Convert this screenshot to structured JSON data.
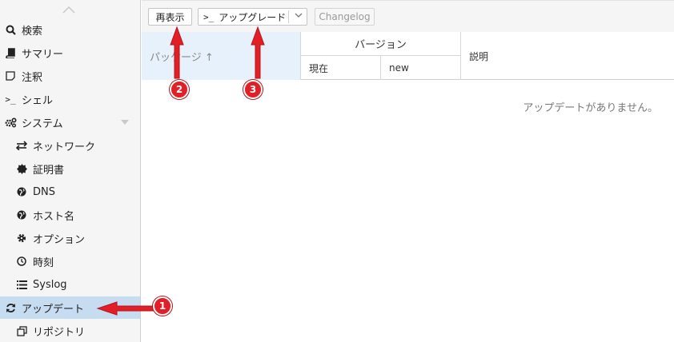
{
  "sidebar": {
    "items": [
      {
        "label": "検索",
        "icon": "search-icon"
      },
      {
        "label": "サマリー",
        "icon": "book-icon"
      },
      {
        "label": "注釈",
        "icon": "note-icon"
      },
      {
        "label": "シェル",
        "icon": "terminal-icon"
      },
      {
        "label": "システム",
        "icon": "gears-icon"
      },
      {
        "label": "ネットワーク",
        "icon": "exchange-icon"
      },
      {
        "label": "証明書",
        "icon": "certificate-icon"
      },
      {
        "label": "DNS",
        "icon": "globe-icon"
      },
      {
        "label": "ホスト名",
        "icon": "globe-icon"
      },
      {
        "label": "オプション",
        "icon": "gear-icon"
      },
      {
        "label": "時刻",
        "icon": "clock-icon"
      },
      {
        "label": "Syslog",
        "icon": "list-icon"
      },
      {
        "label": "アップデート",
        "icon": "refresh-icon"
      },
      {
        "label": "リポジトリ",
        "icon": "copy-icon"
      }
    ],
    "active_item": "アップデート"
  },
  "toolbar": {
    "refresh_label": "再表示",
    "upgrade_prefix": ">_",
    "upgrade_label": "アップグレード",
    "changelog_label": "Changelog"
  },
  "grid": {
    "columns": {
      "package": "パッケージ ↑",
      "version": "バージョン",
      "current": "現在",
      "new": "new",
      "description": "説明"
    },
    "empty_text": "アップデートがありません。"
  },
  "annotations": {
    "badges": [
      "1",
      "2",
      "3"
    ],
    "color": "#e21f26"
  }
}
